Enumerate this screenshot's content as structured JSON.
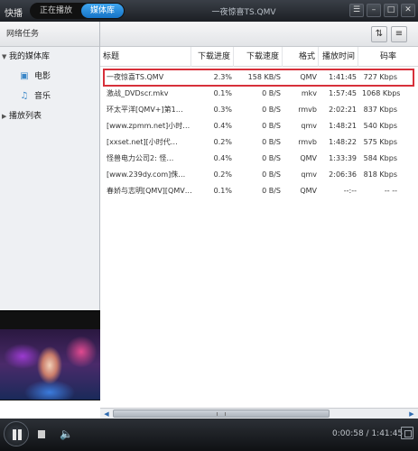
{
  "titlebar": {
    "logo": "快播",
    "tabs": [
      "正在播放",
      "媒体库"
    ],
    "active_tab": 1,
    "window_title": "一夜惊喜TS.QMV",
    "buttons": [
      "menu",
      "minimize",
      "maximize",
      "close"
    ]
  },
  "sidebar": {
    "header": "网络任务",
    "items": [
      {
        "label": "我的媒体库",
        "level": 0,
        "expanded": true
      },
      {
        "label": "电影",
        "level": 1,
        "icon": "film-icon"
      },
      {
        "label": "音乐",
        "level": 1,
        "icon": "music-note-icon"
      },
      {
        "label": "播放列表",
        "level": 0,
        "expanded": false
      }
    ]
  },
  "table": {
    "columns": [
      "标题",
      "下载进度",
      "下载速度",
      "格式",
      "播放时间",
      "码率"
    ],
    "rows": [
      {
        "title": "一夜惊喜TS.QMV",
        "progress": "2.3%",
        "speed": "158 KB/S",
        "format": "QMV",
        "time": "1:41:45",
        "bitrate": "727 Kbps",
        "highlighted": true
      },
      {
        "title": "激战_DVDscr.mkv",
        "progress": "0.1%",
        "speed": "0 B/S",
        "format": "mkv",
        "time": "1:57:45",
        "bitrate": "1068 Kbps"
      },
      {
        "title": "环太平洋[QMV+]第1…",
        "progress": "0.3%",
        "speed": "0 B/S",
        "format": "rmvb",
        "time": "2:02:21",
        "bitrate": "837 Kbps"
      },
      {
        "title": "[www.zpmm.net]小时…",
        "progress": "0.4%",
        "speed": "0 B/S",
        "format": "qmv",
        "time": "1:48:21",
        "bitrate": "540 Kbps"
      },
      {
        "title": "[xxset.net][小时代…",
        "progress": "0.2%",
        "speed": "0 B/S",
        "format": "rmvb",
        "time": "1:48:22",
        "bitrate": "575 Kbps"
      },
      {
        "title": "怪兽电力公司2: 怪…",
        "progress": "0.4%",
        "speed": "0 B/S",
        "format": "QMV",
        "time": "1:33:39",
        "bitrate": "584 Kbps"
      },
      {
        "title": "[www.239dy.com]侏…",
        "progress": "0.2%",
        "speed": "0 B/S",
        "format": "qmv",
        "time": "2:06:36",
        "bitrate": "818 Kbps"
      },
      {
        "title": "春娇与志明[QMV][QMV…",
        "progress": "0.1%",
        "speed": "0 B/S",
        "format": "QMV",
        "time": "--:--",
        "bitrate": "-- --"
      }
    ]
  },
  "controls": {
    "time_display": "0:00:58 / 1:41:45"
  }
}
